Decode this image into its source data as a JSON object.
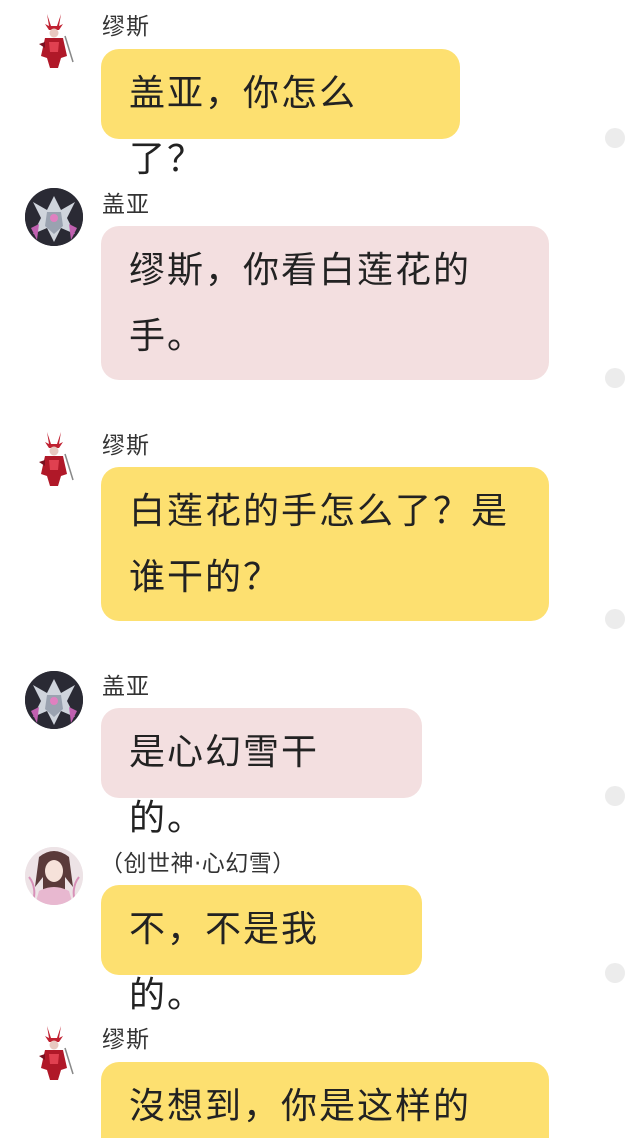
{
  "colors": {
    "bubble_yellow": "#fde070",
    "bubble_pink": "#f3dfe0",
    "side_dot": "#ececec",
    "sender_text": "#333333"
  },
  "messages": [
    {
      "sender": "缪斯",
      "avatar": "red-warrior-avatar-icon",
      "text": "盖亚，你怎么了？",
      "bubble": "yellow"
    },
    {
      "sender": "盖亚",
      "avatar": "silver-armored-avatar-icon",
      "text": "缪斯，你看白莲花的手。",
      "bubble": "pink"
    },
    {
      "sender": "缪斯",
      "avatar": "red-warrior-avatar-icon",
      "text": "白莲花的手怎么了？是谁干的？",
      "bubble": "yellow"
    },
    {
      "sender": "盖亚",
      "avatar": "silver-armored-avatar-icon",
      "text": "是心幻雪干的。",
      "bubble": "pink"
    },
    {
      "sender": "（创世神·心幻雪）",
      "avatar": "pale-anime-avatar-icon",
      "text": "不，不是我的。",
      "bubble": "yellow"
    },
    {
      "sender": "缪斯",
      "avatar": "red-warrior-avatar-icon",
      "text": "沒想到，你是这样的",
      "bubble": "yellow"
    }
  ]
}
